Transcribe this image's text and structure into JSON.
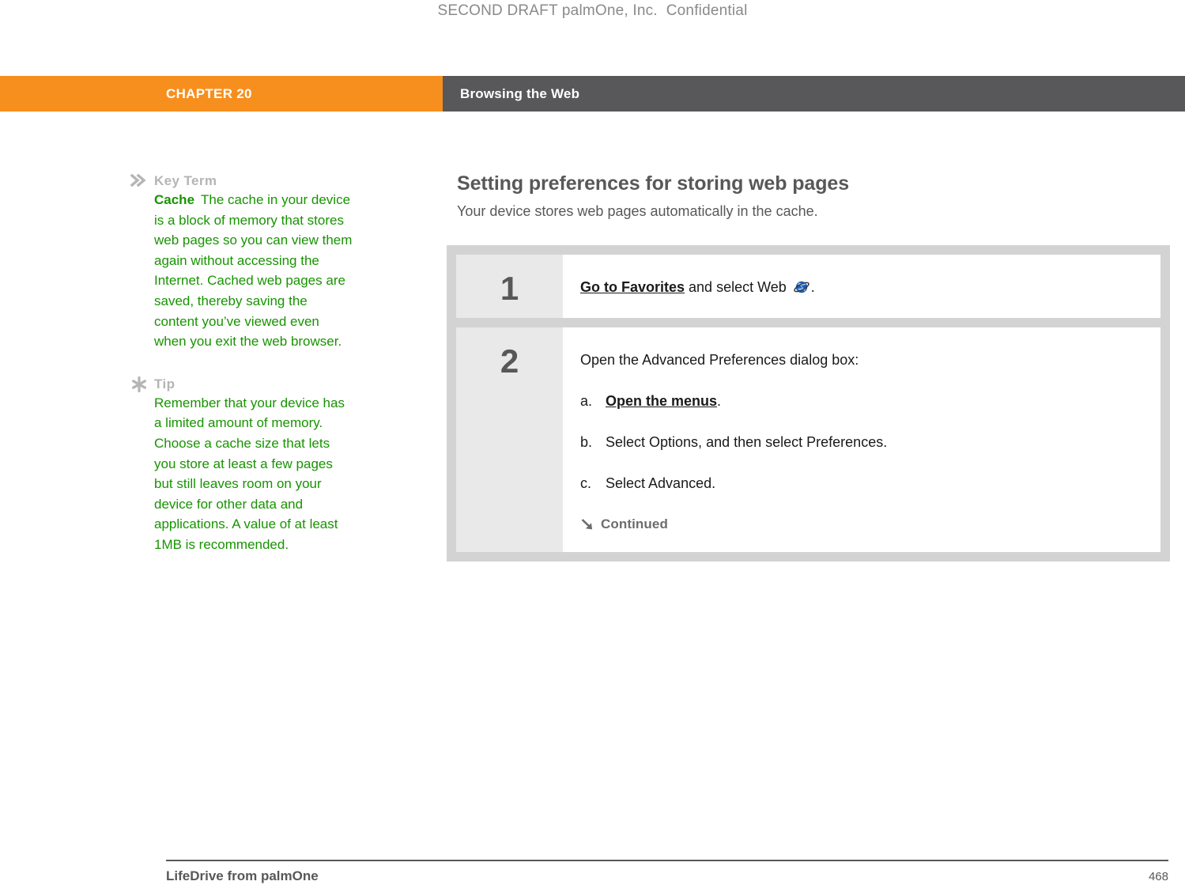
{
  "draft_notice": "SECOND DRAFT palmOne, Inc.  Confidential",
  "chapter_bar": {
    "chapter_label": "CHAPTER 20",
    "chapter_title": "Browsing the Web",
    "orange_hex": "#f78f1e",
    "gray_hex": "#58585a"
  },
  "sidebar": {
    "blocks": [
      {
        "icon": "double-chevron-right-icon",
        "heading": "Key Term",
        "term": "Cache",
        "body": "The cache in your device is a block of memory that stores web pages so you can view them again without accessing the Internet. Cached web pages are saved, thereby saving the content you’ve viewed even when you exit the web browser."
      },
      {
        "icon": "asterisk-icon",
        "heading": "Tip",
        "term": "",
        "body": "Remember that your device has a limited amount of memory. Choose a cache size that lets you store at least a few pages but still leaves room on your device for other data and applications. A value of at least 1MB is recommended."
      }
    ],
    "text_color": "#179400",
    "heading_color": "#b5b5b5"
  },
  "main": {
    "heading": "Setting preferences for storing web pages",
    "subheading": "Your device stores web pages automatically in the cache."
  },
  "steps": [
    {
      "number": "1",
      "lead_bold": "Go to Favorites",
      "lead_rest": " and select Web ",
      "icon": "web-globe-icon",
      "trailing": ".",
      "sub_items": [],
      "continued": null
    },
    {
      "number": "2",
      "lead_bold": "",
      "lead_rest": "Open the Advanced Preferences dialog box:",
      "icon": "",
      "trailing": "",
      "sub_items": [
        {
          "letter": "a.",
          "bold": "Open the menus",
          "rest": "."
        },
        {
          "letter": "b.",
          "bold": "",
          "rest": "Select Options, and then select Preferences."
        },
        {
          "letter": "c.",
          "bold": "",
          "rest": "Select Advanced."
        }
      ],
      "continued": {
        "icon": "arrow-down-right-icon",
        "label": "Continued"
      }
    }
  ],
  "footer": {
    "product": "LifeDrive from palmOne",
    "page_number": "468"
  }
}
